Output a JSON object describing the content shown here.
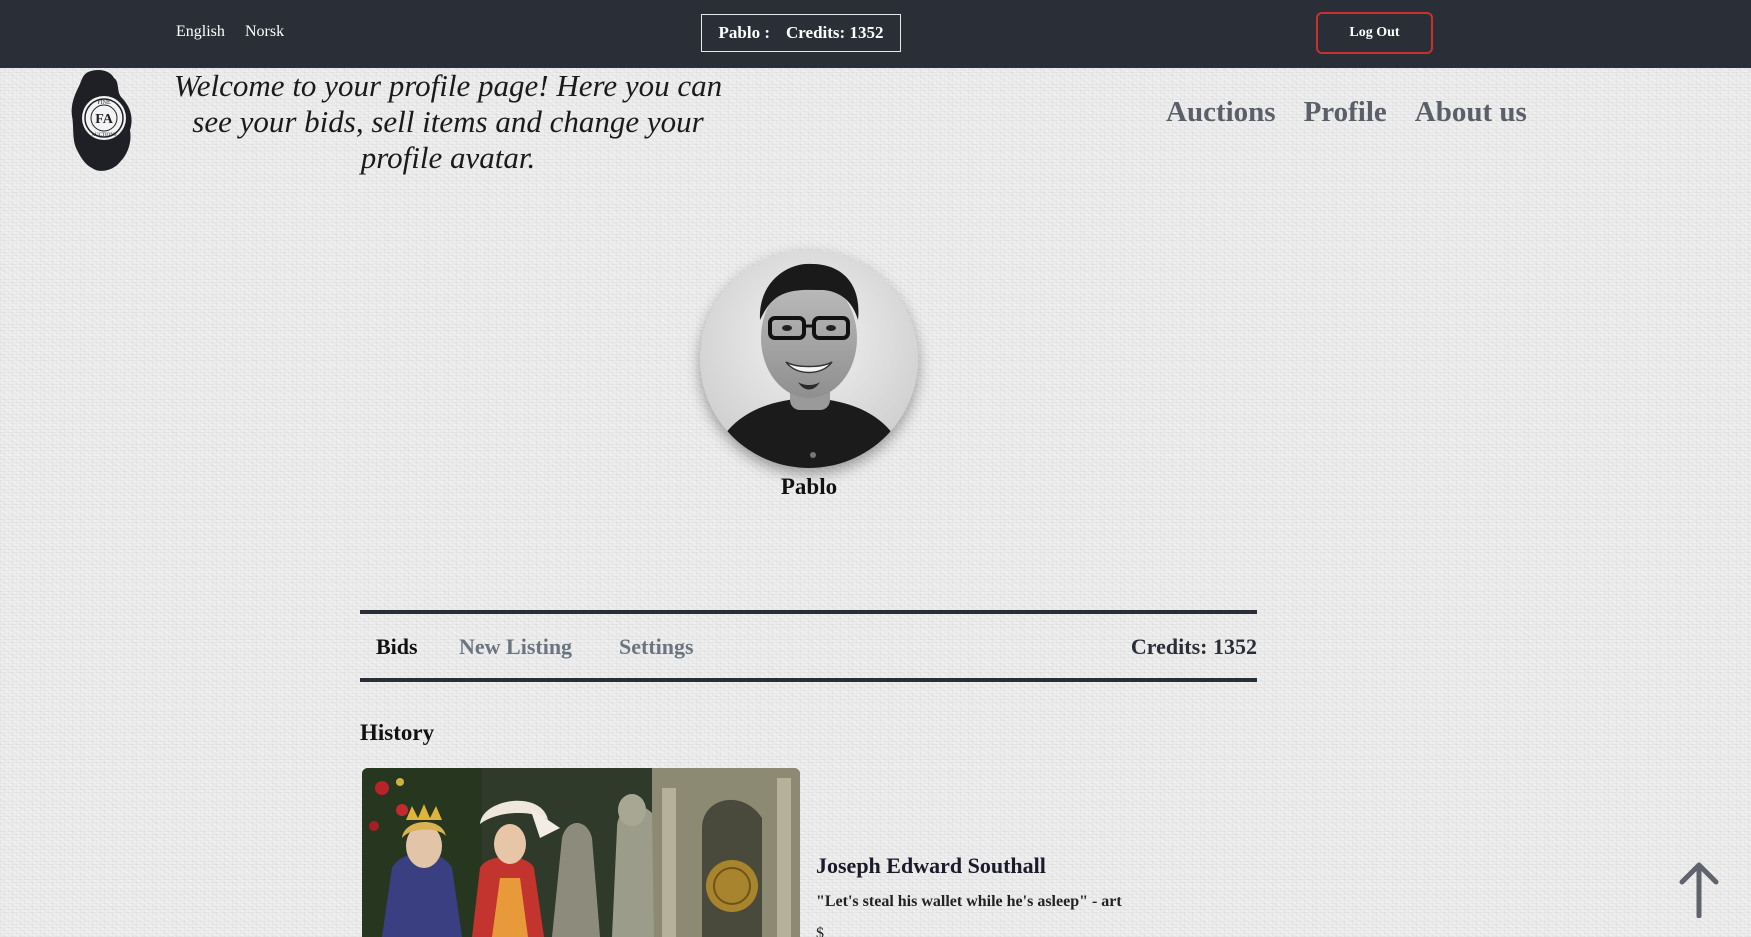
{
  "topbar": {
    "lang_en": "English",
    "lang_no": "Norsk",
    "user_name": "Pablo :",
    "user_credits": "Credits: 1352",
    "logout_label": "Log Out"
  },
  "header": {
    "logo_text": "FINE AUCTIONS",
    "welcome": "Welcome to your profile page! Here you can see your bids, sell items and change your profile avatar."
  },
  "nav": {
    "auctions": "Auctions",
    "profile": "Profile",
    "about": "About us"
  },
  "profile": {
    "name": "Pablo"
  },
  "tabs": {
    "bids": "Bids",
    "new_listing": "New Listing",
    "settings": "Settings",
    "credits": "Credits: 1352"
  },
  "history": {
    "heading": "History",
    "items": [
      {
        "artist": "Joseph Edward Southall",
        "title": "\"Let's steal his wallet while he's asleep\" - art",
        "price": "$"
      }
    ]
  },
  "colors": {
    "topbar_bg": "#2a2f37",
    "logout_border": "#c9302c",
    "nav_text": "#5a5f69",
    "inactive_tab": "#6c7480"
  },
  "icons": {
    "scroll_top": "arrow-up-icon"
  }
}
